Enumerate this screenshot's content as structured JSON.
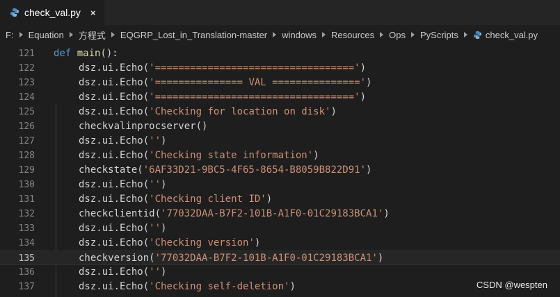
{
  "tab": {
    "filename": "check_val.py",
    "close_glyph": "×",
    "icon": "python-icon"
  },
  "breadcrumb": {
    "items": [
      "F:",
      "Equation",
      "方程式",
      "EQGRP_Lost_in_Translation-master",
      "windows",
      "Resources",
      "Ops",
      "PyScripts",
      "check_val.py"
    ],
    "separator_icon": "chevron-right-icon",
    "file_icon": "python-icon"
  },
  "editor": {
    "current_line": "135",
    "lines": [
      {
        "num": "121",
        "kw": "def",
        "func": "main",
        "rest": "():"
      },
      {
        "num": "122",
        "call": "dsz.ui.Echo(",
        "str": "'=================================='",
        "end": ")"
      },
      {
        "num": "123",
        "call": "dsz.ui.Echo(",
        "str": "'=============== VAL ==============='",
        "end": ")"
      },
      {
        "num": "124",
        "call": "dsz.ui.Echo(",
        "str": "'=================================='",
        "end": ")"
      },
      {
        "num": "125",
        "call": "dsz.ui.Echo(",
        "str": "'Checking for location on disk'",
        "end": ")"
      },
      {
        "num": "126",
        "call": "checkvalinprocserver()",
        "str": "",
        "end": ""
      },
      {
        "num": "127",
        "call": "dsz.ui.Echo(",
        "str": "''",
        "end": ")"
      },
      {
        "num": "128",
        "call": "dsz.ui.Echo(",
        "str": "'Checking state information'",
        "end": ")"
      },
      {
        "num": "129",
        "call": "checkstate(",
        "str": "'6AF33D21-9BC5-4F65-8654-B8059B822D91'",
        "end": ")"
      },
      {
        "num": "130",
        "call": "dsz.ui.Echo(",
        "str": "''",
        "end": ")"
      },
      {
        "num": "131",
        "call": "dsz.ui.Echo(",
        "str": "'Checking client ID'",
        "end": ")"
      },
      {
        "num": "132",
        "call": "checkclientid(",
        "str": "'77032DAA-B7F2-101B-A1F0-01C29183BCA1'",
        "end": ")"
      },
      {
        "num": "133",
        "call": "dsz.ui.Echo(",
        "str": "''",
        "end": ")"
      },
      {
        "num": "134",
        "call": "dsz.ui.Echo(",
        "str": "'Checking version'",
        "end": ")"
      },
      {
        "num": "135",
        "call": "checkversion(",
        "str": "'77032DAA-B7F2-101B-A1F0-01C29183BCA1'",
        "end": ")"
      },
      {
        "num": "136",
        "call": "dsz.ui.Echo(",
        "str": "''",
        "end": ")"
      },
      {
        "num": "137",
        "call": "dsz.ui.Echo(",
        "str": "'Checking self-deletion'",
        "end": ")"
      }
    ]
  },
  "watermark": "CSDN @wespten",
  "colors": {
    "keyword": "#569cd6",
    "function": "#dcdcaa",
    "string": "#ce9178",
    "text": "#d4d4d4",
    "background": "#1e1e1e"
  }
}
